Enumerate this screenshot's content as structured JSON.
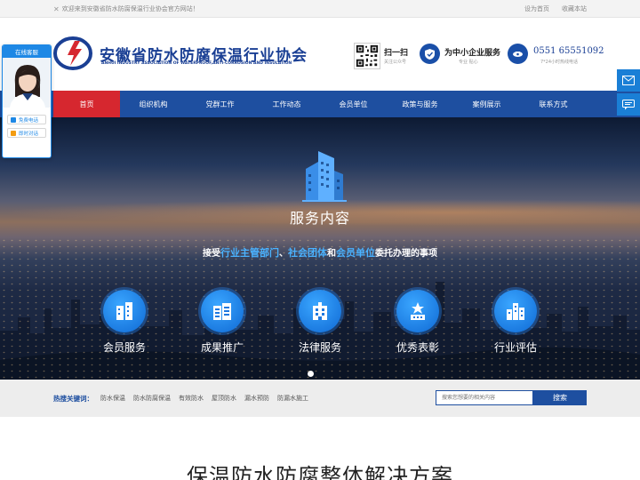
{
  "topbar": {
    "welcome": "欢迎来到安徽省防水防腐保温行业协会官方网站！",
    "set_home": "设为首页",
    "bookmark": "收藏本站"
  },
  "header": {
    "logo_cn": "安徽省防水防腐保温行业协会",
    "logo_en": "ANHUI INDUSTRY ASSOCIATION OF WATERPROOF,ANTI-CORROSION AND INSULATION",
    "qr_title": "扫一扫",
    "qr_sub": "关注公众号",
    "service_title": "为中小企业服务",
    "service_sub": "专业  贴心",
    "phone": "0551 65551092",
    "phone_sub": "7*24小时热线电话"
  },
  "nav": {
    "items": [
      {
        "label": "首页",
        "active": true
      },
      {
        "label": "组织机构"
      },
      {
        "label": "党群工作"
      },
      {
        "label": "工作动态"
      },
      {
        "label": "会员单位"
      },
      {
        "label": "政策与服务"
      },
      {
        "label": "案例展示"
      },
      {
        "label": "联系方式"
      }
    ]
  },
  "banner": {
    "heading": "服务内容",
    "line_pre": "接受",
    "line_hl1": "行业主管部门",
    "line_sep1": "、",
    "line_hl2": "社会团体",
    "line_mid": "和",
    "line_hl3": "会员单位",
    "line_post": "委托办理的事项",
    "features": [
      {
        "label": "会员服务",
        "icon": "member-icon"
      },
      {
        "label": "成果推广",
        "icon": "promotion-icon"
      },
      {
        "label": "法律服务",
        "icon": "legal-icon"
      },
      {
        "label": "优秀表彰",
        "icon": "award-icon"
      },
      {
        "label": "行业评估",
        "icon": "assessment-icon"
      }
    ]
  },
  "hot": {
    "label": "热搜关键词：",
    "keywords": [
      "防水保温",
      "防水防腐保温",
      "有效防水",
      "屋顶防水",
      "漏水预防",
      "防漏水施工"
    ],
    "search_placeholder": "搜索您想要的相关内容",
    "search_button": "搜索"
  },
  "section": {
    "title": "保温防水防腐整体解决方案"
  },
  "kefu": {
    "title": "在线客服",
    "call_label": "免费电话",
    "chat_label": "即时对话"
  },
  "colors": {
    "brand_blue": "#1e4fa0",
    "active_red": "#d6272f",
    "accent_light_blue": "#4ab2ff"
  }
}
